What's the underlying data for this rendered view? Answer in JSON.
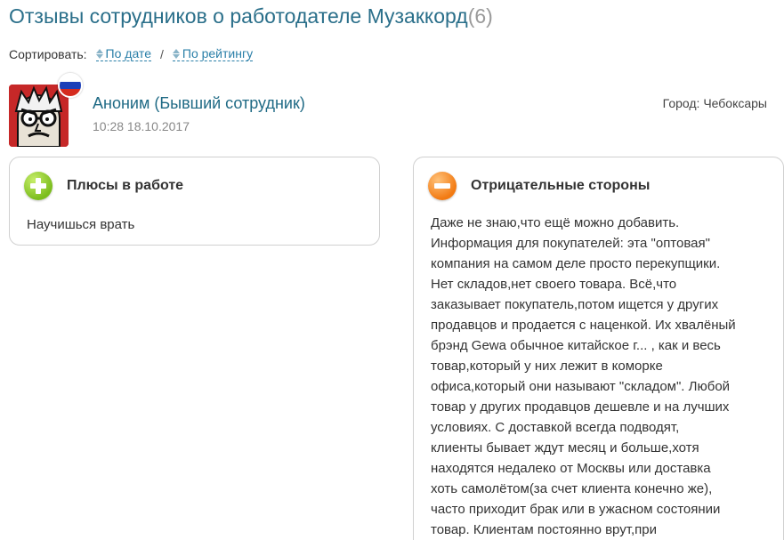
{
  "header": {
    "title": "Отзывы сотрудников о работодателе Музаккорд",
    "count": "(6)"
  },
  "sort": {
    "label": "Сортировать:",
    "by_date": "По дате",
    "separator": "/",
    "by_rating": "По рейтингу"
  },
  "review": {
    "author": "Аноним (Бывший сотрудник)",
    "date": "10:28 18.10.2017",
    "city": "Город: Чебоксары",
    "flag_colors": [
      "#ffffff",
      "#1c3fb8",
      "#d52b1e"
    ],
    "pros": {
      "icon": "plus-circle-icon",
      "title": "Плюсы в работе",
      "text": "Научишься врать"
    },
    "cons": {
      "icon": "minus-circle-icon",
      "title": "Отрицательные стороны",
      "lines": [
        "Даже не знаю,что ещё можно добавить.",
        "Информация для покупателей: эта \"оптовая\"",
        "компания на самом деле просто перекупщики.",
        "Нет складов,нет своего товара. Всё,что",
        "заказывает покупатель,потом ищется у других",
        "продавцов и продается с наценкой. Их хвалёный",
        "брэнд Gewa обычное китайское г... , как и весь",
        "товар,который у них лежит в коморке",
        "офиса,который они называют \"складом\". Любой",
        "товар у других продавцов дешевле и на лучших",
        "условиях. С доставкой всегда подводят,",
        "клиенты бывает ждут месяц и больше,хотя",
        "находятся недалеко от Москвы или доставка",
        "хоть самолётом(за счет клиента конечно же),",
        "часто приходит брак или в ужасном состоянии",
        "товар. Клиентам постоянно врут,при"
      ]
    }
  },
  "colors": {
    "title": "#2a6f8a",
    "link": "#2a7fa8",
    "plus": "#7cbd1e",
    "minus": "#f27a12"
  }
}
